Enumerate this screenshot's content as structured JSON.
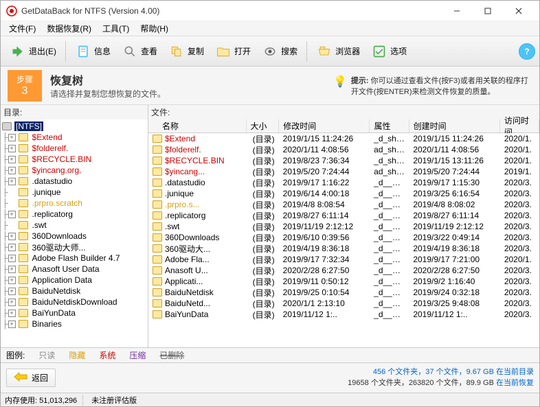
{
  "window": {
    "title": "GetDataBack for NTFS (Version 4.00)"
  },
  "menu": {
    "file": "文件(F)",
    "recover": "数据恢复(R)",
    "tools": "工具(T)",
    "help": "帮助(H)"
  },
  "toolbar": {
    "exit": "退出(E)",
    "info": "信息",
    "view": "查看",
    "copy": "复制",
    "open": "打开",
    "search": "搜索",
    "browser": "浏览器",
    "options": "选项"
  },
  "step": {
    "label": "步骤",
    "num": "3",
    "title": "恢复树",
    "desc": "请选择并复制您想恢复的文件。"
  },
  "hint": {
    "label": "提示:",
    "text": "你可以通过查看文件(按F3)或者用关联的程序打开文件(按ENTER)来检测文件恢复的质量。"
  },
  "panes": {
    "dir_label": "目录:",
    "file_label": "文件:",
    "root": "[NTFS]"
  },
  "tree": [
    {
      "name": "$Extend",
      "red": true,
      "exp": "+"
    },
    {
      "name": "$folderelf.",
      "red": true,
      "exp": "+"
    },
    {
      "name": "$RECYCLE.BIN",
      "red": true,
      "exp": "+"
    },
    {
      "name": "$yincang.org.",
      "red": true,
      "exp": "+"
    },
    {
      "name": ".datastudio",
      "red": false,
      "exp": "+"
    },
    {
      "name": ".junique",
      "red": false,
      "exp": ""
    },
    {
      "name": ".prpro.scratch",
      "red": false,
      "exp": "",
      "hidden": true
    },
    {
      "name": ".replicatorg",
      "red": false,
      "exp": "+"
    },
    {
      "name": ".swt",
      "red": false,
      "exp": ""
    },
    {
      "name": "360Downloads",
      "red": false,
      "exp": "+"
    },
    {
      "name": "360驱动大师...",
      "red": false,
      "exp": "+"
    },
    {
      "name": "Adobe Flash Builder 4.7",
      "red": false,
      "exp": "+"
    },
    {
      "name": "Anasoft User Data",
      "red": false,
      "exp": "+"
    },
    {
      "name": "Application Data",
      "red": false,
      "exp": "+"
    },
    {
      "name": "BaiduNetdisk",
      "red": false,
      "exp": "+"
    },
    {
      "name": "BaiduNetdiskDownload",
      "red": false,
      "exp": "+"
    },
    {
      "name": "BaiYunData",
      "red": false,
      "exp": "+"
    },
    {
      "name": "Binaries",
      "red": false,
      "exp": "+"
    }
  ],
  "columns": {
    "name": "名称",
    "size": "大小",
    "modified": "修改时间",
    "attr": "属性",
    "created": "创建时间",
    "accessed": "访问时间"
  },
  "files": [
    {
      "name": "$Extend",
      "red": true,
      "size": "(目录)",
      "mod": "2019/1/15 11:24:26",
      "attr": "_d_sh__",
      "create": "2019/1/15 11:24:26",
      "access": "2020/1."
    },
    {
      "name": "$folderelf.",
      "red": true,
      "size": "(目录)",
      "mod": "2020/1/11 4:08:56",
      "attr": "ad_sh__",
      "create": "2020/1/11 4:08:56",
      "access": "2020/1."
    },
    {
      "name": "$RECYCLE.BIN",
      "red": true,
      "size": "(目录)",
      "mod": "2019/8/23 7:36:34",
      "attr": "_d_sh__",
      "create": "2019/1/15 13:11:26",
      "access": "2020/1."
    },
    {
      "name": "$yincang...",
      "red": true,
      "size": "(目录)",
      "mod": "2019/5/20 7:24:44",
      "attr": "ad_sh__",
      "create": "2019/5/20 7:24:44",
      "access": "2019/1."
    },
    {
      "name": ".datastudio",
      "red": false,
      "size": "(目录)",
      "mod": "2019/9/17 1:16:22",
      "attr": "_d_____",
      "create": "2019/9/17 1:15:30",
      "access": "2020/3."
    },
    {
      "name": ".junique",
      "red": false,
      "size": "(目录)",
      "mod": "2019/6/14 4:00:18",
      "attr": "_d_____",
      "create": "2019/3/25 6:16:54",
      "access": "2020/3."
    },
    {
      "name": ".prpro.s...",
      "red": false,
      "hidden": true,
      "size": "(目录)",
      "mod": "2019/4/8 8:08:54",
      "attr": "_d__h__",
      "create": "2019/4/8 8:08:02",
      "access": "2020/3."
    },
    {
      "name": ".replicatorg",
      "red": false,
      "size": "(目录)",
      "mod": "2019/8/27 6:11:14",
      "attr": "_d_____",
      "create": "2019/8/27 6:11:14",
      "access": "2020/3."
    },
    {
      "name": ".swt",
      "red": false,
      "size": "(目录)",
      "mod": "2019/11/19 2:12:12",
      "attr": "_d_____",
      "create": "2019/11/19 2:12:12",
      "access": "2020/3."
    },
    {
      "name": "360Downloads",
      "red": false,
      "size": "(目录)",
      "mod": "2019/6/10 0:39:56",
      "attr": "_d_____",
      "create": "2019/3/22 0:49:14",
      "access": "2020/3."
    },
    {
      "name": "360驱动大...",
      "red": false,
      "size": "(目录)",
      "mod": "2019/4/19 8:36:18",
      "attr": "_d_____",
      "create": "2019/4/19 8:36:18",
      "access": "2020/3."
    },
    {
      "name": "Adobe Fla...",
      "red": false,
      "size": "(目录)",
      "mod": "2019/9/17 7:32:34",
      "attr": "_d_____",
      "create": "2019/9/17 7:21:00",
      "access": "2020/1."
    },
    {
      "name": "Anasoft U...",
      "red": false,
      "size": "(目录)",
      "mod": "2020/2/28 6:27:50",
      "attr": "_d_____",
      "create": "2020/2/28 6:27:50",
      "access": "2020/3."
    },
    {
      "name": "Applicati...",
      "red": false,
      "size": "(目录)",
      "mod": "2019/9/11 0:50:12",
      "attr": "_d_____",
      "create": "2019/9/2 1:16:40",
      "access": "2020/3."
    },
    {
      "name": "BaiduNetdisk",
      "red": false,
      "size": "(目录)",
      "mod": "2019/9/25 0:10:54",
      "attr": "_d_____",
      "create": "2019/9/24 0:32:18",
      "access": "2020/3."
    },
    {
      "name": "BaiduNetd...",
      "red": false,
      "size": "(目录)",
      "mod": "2020/1/1 2:13:10",
      "attr": "_d_____",
      "create": "2019/3/25 9:48:08",
      "access": "2020/3."
    },
    {
      "name": "BaiYunData",
      "red": false,
      "size": "(目录)",
      "mod": "2019/11/12 1:..",
      "attr": "_d_____",
      "create": "2019/11/12 1:..",
      "access": "2020/3."
    }
  ],
  "legend": {
    "label": "图例:",
    "readonly": "只读",
    "hidden": "隐藏",
    "system": "系统",
    "compressed": "压缩",
    "deleted": "已删除"
  },
  "back": {
    "label": "返回"
  },
  "stats": {
    "line1_a": "456 个文件夹，37 个文件，9.67 GB",
    "line1_b": "在当前目录",
    "line2_a": "19658 个文件夹，263820 个文件，89.9 GB",
    "line2_b": "在当前恢复"
  },
  "status": {
    "mem_label": "内存使用:",
    "mem_value": "51,013,296",
    "eval": "未注册评估版"
  }
}
